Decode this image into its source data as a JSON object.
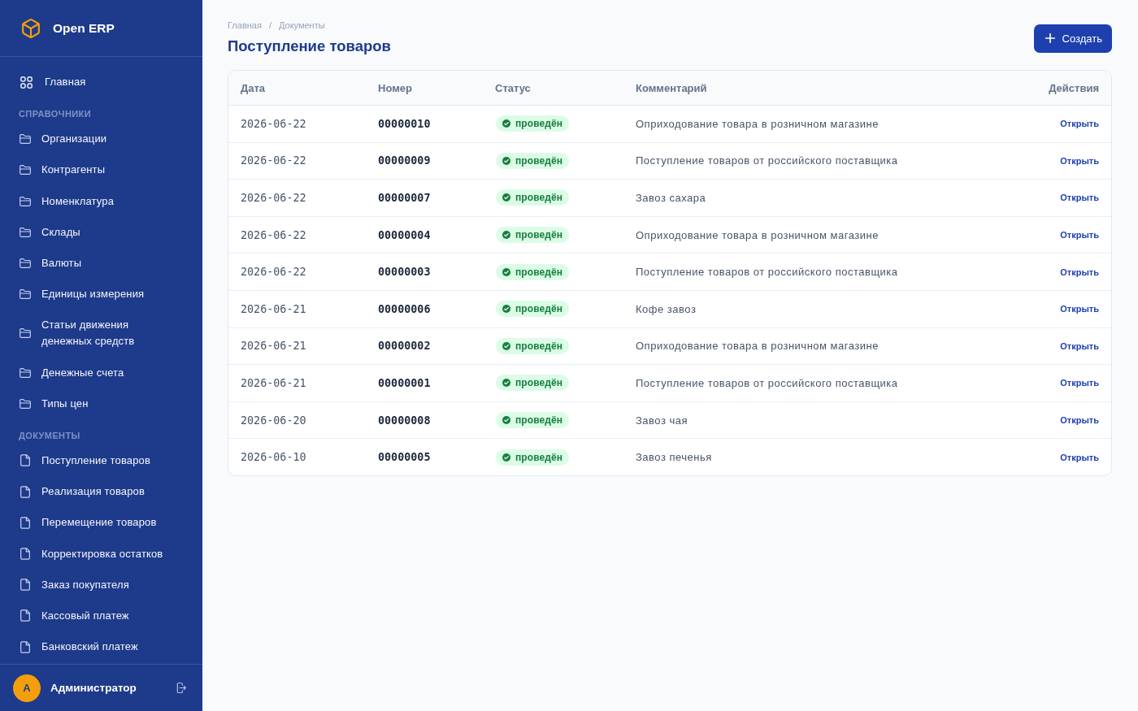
{
  "sidebar": {
    "brand": "Open ERP",
    "home": {
      "label": "Главная"
    },
    "sections": [
      {
        "title": "СПРАВОЧНИКИ",
        "kind": "catalog",
        "items": [
          "Организации",
          "Контрагенты",
          "Номенклатура",
          "Склады",
          "Валюты",
          "Единицы измерения",
          "Статьи движения денежных средств",
          "Денежные счета",
          "Типы цен"
        ]
      },
      {
        "title": "ДОКУМЕНТЫ",
        "kind": "document",
        "items": [
          "Поступление товаров",
          "Реализация товаров",
          "Перемещение товаров",
          "Корректировка остатков",
          "Заказ покупателя",
          "Кассовый платеж",
          "Банковский платеж"
        ]
      }
    ],
    "user": {
      "initial": "А",
      "name": "Администратор"
    }
  },
  "breadcrumbs": [
    {
      "label": "Главная"
    },
    {
      "label": "Документы"
    }
  ],
  "breadcrumb_separator": "/",
  "page_title": "Поступление товаров",
  "create_button": {
    "label": "Создать"
  },
  "table": {
    "columns": [
      "Дата",
      "Номер",
      "Статус",
      "Комментарий",
      "Действия"
    ],
    "rows": [
      {
        "date": "2026-06-22",
        "number": "00000010",
        "status": {
          "kind": "posted",
          "label": "проведён"
        },
        "comment": "Оприходование товара в розничном магазине",
        "action": "Открыть"
      },
      {
        "date": "2026-06-22",
        "number": "00000009",
        "status": {
          "kind": "posted",
          "label": "проведён"
        },
        "comment": "Поступление товаров от российского поставщика",
        "action": "Открыть"
      },
      {
        "date": "2026-06-22",
        "number": "00000007",
        "status": {
          "kind": "posted",
          "label": "проведён"
        },
        "comment": "Завоз сахара",
        "action": "Открыть"
      },
      {
        "date": "2026-06-22",
        "number": "00000004",
        "status": {
          "kind": "posted",
          "label": "проведён"
        },
        "comment": "Оприходование товара в розничном магазине",
        "action": "Открыть"
      },
      {
        "date": "2026-06-22",
        "number": "00000003",
        "status": {
          "kind": "posted",
          "label": "проведён"
        },
        "comment": "Поступление товаров от российского поставщика",
        "action": "Открыть"
      },
      {
        "date": "2026-06-21",
        "number": "00000006",
        "status": {
          "kind": "posted",
          "label": "проведён"
        },
        "comment": "Кофе завоз",
        "action": "Открыть"
      },
      {
        "date": "2026-06-21",
        "number": "00000002",
        "status": {
          "kind": "posted",
          "label": "проведён"
        },
        "comment": "Оприходование товара в розничном магазине",
        "action": "Открыть"
      },
      {
        "date": "2026-06-21",
        "number": "00000001",
        "status": {
          "kind": "posted",
          "label": "проведён"
        },
        "comment": "Поступление товаров от российского поставщика",
        "action": "Открыть"
      },
      {
        "date": "2026-06-20",
        "number": "00000008",
        "status": {
          "kind": "posted",
          "label": "проведён"
        },
        "comment": "Завоз чая",
        "action": "Открыть"
      },
      {
        "date": "2026-06-10",
        "number": "00000005",
        "status": {
          "kind": "posted",
          "label": "проведён"
        },
        "comment": "Завоз печенья",
        "action": "Открыть"
      }
    ]
  }
}
